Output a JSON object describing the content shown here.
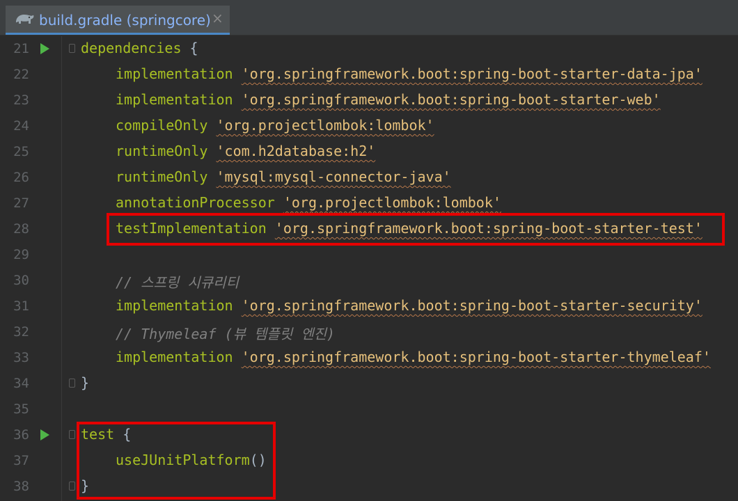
{
  "tab": {
    "title": "build.gradle (springcore)",
    "close": "×",
    "icon": "gradle-elephant-icon"
  },
  "colors": {
    "background": "#2b2b2b",
    "keyword": "#a8c023",
    "string": "#e6c07b",
    "comment": "#808080",
    "line_number": "#606366",
    "run_marker": "#4fb548",
    "highlight_box": "#e50000"
  },
  "lines": [
    {
      "number": "21",
      "kw": "dependencies",
      "rest": " {"
    },
    {
      "number": "22",
      "kw": "implementation",
      "str": "'org.springframework.boot:spring-boot-starter-data-jpa'"
    },
    {
      "number": "23",
      "kw": "implementation",
      "str": "'org.springframework.boot:spring-boot-starter-web'"
    },
    {
      "number": "24",
      "kw": "compileOnly",
      "str": "'org.projectlombok:lombok'"
    },
    {
      "number": "25",
      "kw": "runtimeOnly",
      "str": "'com.h2database:h2'"
    },
    {
      "number": "26",
      "kw": "runtimeOnly",
      "str": "'mysql:mysql-connector-java'"
    },
    {
      "number": "27",
      "kw": "annotationProcessor",
      "str": "'org.projectlombok:lombok'"
    },
    {
      "number": "28",
      "kw": "testImplementation",
      "str": "'org.springframework.boot:spring-boot-starter-test'"
    },
    {
      "number": "29"
    },
    {
      "number": "30",
      "comment": "// 스프링 시큐리티"
    },
    {
      "number": "31",
      "kw": "implementation",
      "str": "'org.springframework.boot:spring-boot-starter-security'"
    },
    {
      "number": "32",
      "comment": "// Thymeleaf (뷰 템플릿 엔진)"
    },
    {
      "number": "33",
      "kw": "implementation",
      "str": "'org.springframework.boot:spring-boot-starter-thymeleaf'"
    },
    {
      "number": "34",
      "plain": "}"
    },
    {
      "number": "35"
    },
    {
      "number": "36",
      "kw": "test",
      "rest": " {"
    },
    {
      "number": "37",
      "kw": "useJUnitPlatform",
      "rest": "()"
    },
    {
      "number": "38",
      "plain": "}"
    }
  ]
}
